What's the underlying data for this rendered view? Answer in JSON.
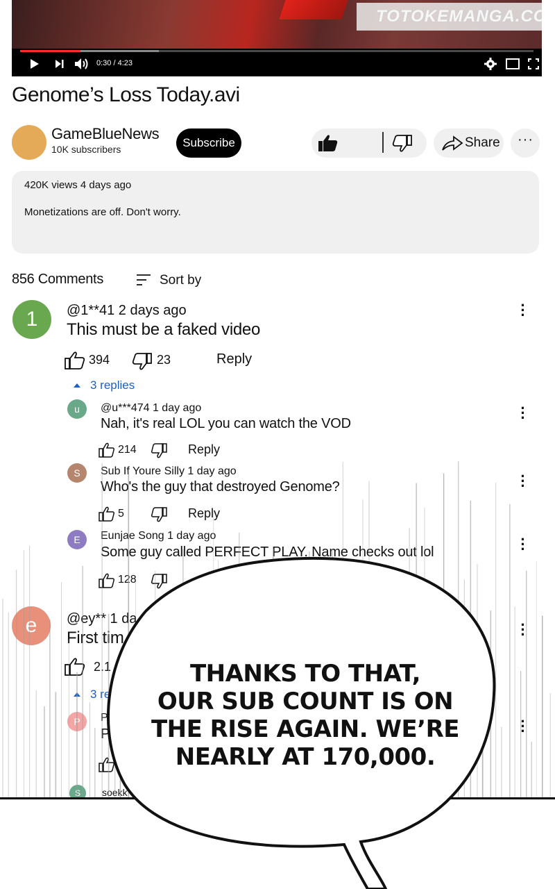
{
  "player": {
    "watermark": "TOTOKEMANGA.COM",
    "time": "0:30 / 4:23",
    "progress_fraction": 0.118,
    "buffer_fraction": 0.27,
    "icons": [
      "play-icon",
      "next-icon",
      "volume-icon",
      "settings-icon",
      "miniplayer-icon",
      "fullscreen-icon"
    ]
  },
  "video": {
    "title": "Genome’s Loss Today.avi"
  },
  "channel": {
    "name": "GameBlueNews",
    "subscribers": "10K subscribers",
    "subscribe_label": "Subscribe",
    "avatar_color": "#e5aa57"
  },
  "actions": {
    "share_label": "Share",
    "more_label": "···"
  },
  "description": {
    "stats": "420K views 4 days ago",
    "text": "Monetizations are off. Don't worry."
  },
  "comments_header": {
    "count": "856 Comments",
    "sort_label": "Sort by"
  },
  "comments": [
    {
      "avatar_letter": "1",
      "avatar_color": "#6aa84f",
      "author_time": "@1**41 2 days ago",
      "text": "This must be a faked video",
      "likes": "394",
      "dislikes": "23",
      "reply_label": "Reply",
      "replies_label": "3 replies",
      "replies": [
        {
          "avatar_letter": "u",
          "avatar_color": "#6aa88a",
          "author_time": "@u***474 1 day ago",
          "text": "Nah, it's real LOL you can watch the VOD",
          "likes": "214",
          "reply_label": "Reply"
        },
        {
          "avatar_letter": "S",
          "avatar_color": "#b5856e",
          "author_time": "Sub If Youre Silly 1 day ago",
          "text": "Who's the guy that destroyed Genome?",
          "likes": "5",
          "reply_label": "Reply"
        },
        {
          "avatar_letter": "E",
          "avatar_color": "#8e7cc3",
          "author_time": "Eunjae Song 1 day ago",
          "text": "Some guy called PERFECT PLAY. Name checks out lol",
          "likes": "128"
        }
      ]
    },
    {
      "avatar_letter": "e",
      "avatar_color": "#e8907a",
      "author_time": "@ey** 1 da",
      "text": "First tim",
      "likes": "2.1",
      "replies_label": "3 re",
      "replies": [
        {
          "avatar_letter": "P",
          "avatar_color": "#f4a6a6",
          "author_time": "P",
          "text": "P"
        },
        {
          "avatar_letter": "S",
          "avatar_color": "#6aa88a",
          "author_time": "soekk"
        }
      ]
    }
  ],
  "speech_bubble": {
    "lines": [
      "THANKS TO THAT,",
      "OUR SUB COUNT IS ON",
      "THE RISE AGAIN. WE’RE",
      "NEARLY AT 170,000."
    ]
  }
}
